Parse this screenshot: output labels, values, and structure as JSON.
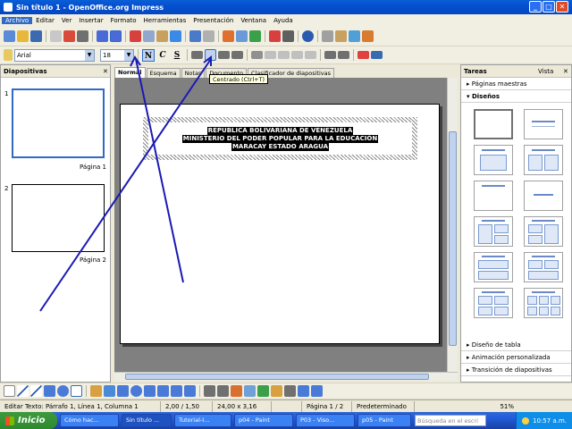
{
  "window": {
    "title": "Sin título 1 - OpenOffice.org Impress",
    "min": "_",
    "max": "□",
    "close": "✕"
  },
  "menu": [
    "Archivo",
    "Editar",
    "Ver",
    "Insertar",
    "Formato",
    "Herramientas",
    "Presentación",
    "Ventana",
    "Ayuda"
  ],
  "format_bar": {
    "font": "Arial",
    "size": "18",
    "bold": "N",
    "italic": "C",
    "underline": "S",
    "tooltip": "Centrado (Ctrl+T)"
  },
  "left_panel": {
    "title": "Diapositivas",
    "slides": [
      {
        "number": "1",
        "label": "Página 1"
      },
      {
        "number": "2",
        "label": "Página 2"
      }
    ]
  },
  "tabs": [
    "Normal",
    "Esquema",
    "Notas",
    "Documento",
    "Clasificador de diapositivas"
  ],
  "slide": {
    "lines": [
      "REPUBLICA BOLIVARIANA DE VENEZUELA",
      "MINISTERIO DEL PODER POPULAR PARA LA EDUCACIÓN",
      "MARACAY ESTADO ARAGUA"
    ]
  },
  "right_panel": {
    "title": "Tareas",
    "view": "Vista",
    "sections_top": [
      "Páginas maestras",
      "Diseños"
    ],
    "sections_bottom": [
      "Diseño de tabla",
      "Animación personalizada",
      "Transición de diapositivas"
    ]
  },
  "status": {
    "text": "Editar Texto: Párrafo 1, Línea 1, Columna 1",
    "position": "2,00 / 1,50",
    "size": "24,00 x 3,16",
    "page": "Página 1 / 2",
    "master": "Predeterminado",
    "zoom": "51%"
  },
  "taskbar": {
    "start": "Inicio",
    "tasks": [
      "Cómo hac...",
      "Sin título ...",
      "Tutorial-I...",
      "p04 - Paint",
      "P03 - Viso...",
      "p05 - Paint"
    ],
    "search_placeholder": "Búsqueda en el escri",
    "clock": "10:57 a.m."
  },
  "colors": {
    "arrow": "#1a1ab4",
    "selection": "#316ac5",
    "titlebar": "#0550d0"
  }
}
